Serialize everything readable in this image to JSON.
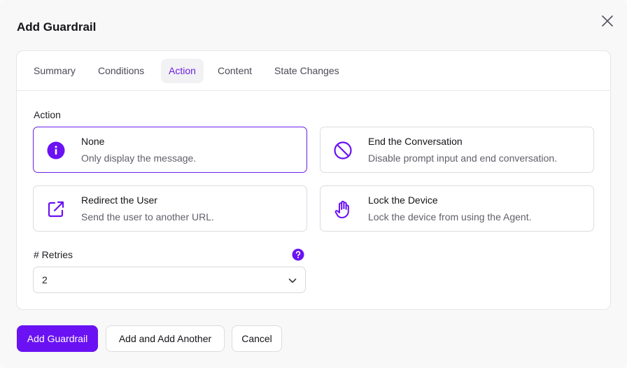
{
  "modal": {
    "title": "Add Guardrail"
  },
  "tabs": [
    {
      "label": "Summary"
    },
    {
      "label": "Conditions"
    },
    {
      "label": "Action"
    },
    {
      "label": "Content"
    },
    {
      "label": "State Changes"
    }
  ],
  "active_tab": "Action",
  "action": {
    "section_label": "Action",
    "selected": "None",
    "options": [
      {
        "title": "None",
        "description": "Only display the message.",
        "icon": "info-icon"
      },
      {
        "title": "End the Conversation",
        "description": "Disable prompt input and end conversation.",
        "icon": "block-icon"
      },
      {
        "title": "Redirect the User",
        "description": "Send the user to another URL.",
        "icon": "external-link-icon"
      },
      {
        "title": "Lock the Device",
        "description": "Lock the device from using the Agent.",
        "icon": "hand-icon"
      }
    ]
  },
  "retries": {
    "label": "# Retries",
    "value": "2"
  },
  "footer": {
    "add_label": "Add Guardrail",
    "add_another_label": "Add and Add Another",
    "cancel_label": "Cancel"
  },
  "colors": {
    "accent": "#6a12f3",
    "selected_border": "#6a1fe6",
    "active_tab_text": "#6b1fe0"
  }
}
